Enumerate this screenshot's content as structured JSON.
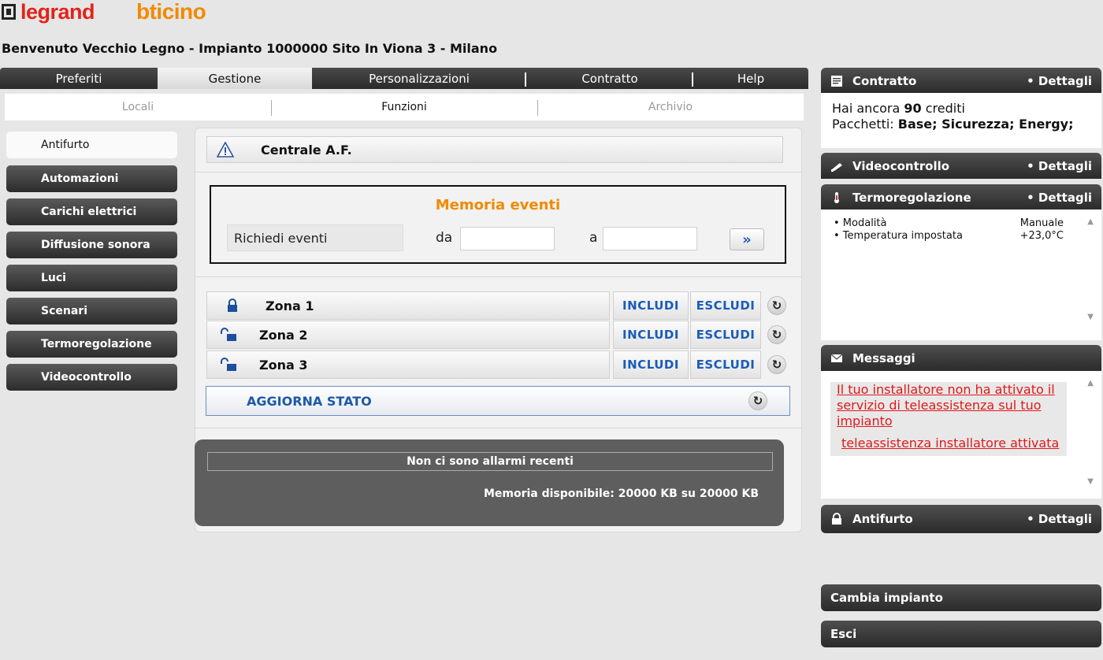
{
  "header": {
    "logo_legrand": "legrand",
    "logo_bticino": "bticino",
    "welcome": "Benvenuto Vecchio Legno - Impianto 1000000 Sito In Viona 3 - Milano"
  },
  "top_tabs": [
    "Preferiti",
    "Gestione",
    "Personalizzazioni",
    "Contratto",
    "Help"
  ],
  "active_top_tab": "Gestione",
  "sub_tabs": [
    "Locali",
    "Funzioni",
    "Archivio"
  ],
  "active_sub_tab": "Funzioni",
  "side_menu": [
    "Antifurto",
    "Automazioni",
    "Carichi elettrici",
    "Diffusione sonora",
    "Luci",
    "Scenari",
    "Termoregolazione",
    "Videocontrollo"
  ],
  "active_side": "Antifurto",
  "centrale": {
    "title": "Centrale A.F.",
    "icon": "warning-icon"
  },
  "memoria": {
    "title": "Memoria eventi",
    "richiedi": "Richiedi eventi",
    "da_label": "da",
    "a_label": "a",
    "da_value": "",
    "a_value": "",
    "go_label": "»"
  },
  "zones": [
    {
      "name": "Zona 1",
      "state": "locked",
      "icon": "lock-closed-icon"
    },
    {
      "name": "Zona 2",
      "state": "unlocked",
      "icon": "lock-open-icon"
    },
    {
      "name": "Zona 3",
      "state": "unlocked",
      "icon": "lock-open-icon"
    }
  ],
  "zone_buttons": {
    "include": "INCLUDI",
    "exclude": "ESCLUDI",
    "refresh_glyph": "↻"
  },
  "aggiorna": "AGGIORNA STATO",
  "alarms": {
    "message": "Non ci sono allarmi recenti",
    "memory": "Memoria disponibile: 20000 KB su 20000 KB"
  },
  "right": {
    "contratto": {
      "title": "Contratto",
      "details": "• Dettagli",
      "credits_prefix": "Hai ancora ",
      "credits_value": "90",
      "credits_suffix": " crediti",
      "packages_label": "Pacchetti: ",
      "packages_value": "Base; Sicurezza; Energy;"
    },
    "videocontrollo": {
      "title": "Videocontrollo",
      "details": "• Dettagli"
    },
    "termoregolazione": {
      "title": "Termoregolazione",
      "details": "• Dettagli",
      "rows": [
        {
          "label": "• Modalità",
          "value": "Manuale"
        },
        {
          "label": "• Temperatura impostata",
          "value": "+23,0°C"
        }
      ]
    },
    "messaggi": {
      "title": "Messaggi",
      "items": [
        "Il tuo installatore non ha attivato il servizio di teleassistenza sul tuo impianto",
        "teleassistenza installatore attivata"
      ]
    },
    "antifurto": {
      "title": "Antifurto",
      "details": "• Dettagli"
    },
    "cambia_impianto": "Cambia impianto",
    "esci": "Esci"
  },
  "colors": {
    "accent_orange": "#f08a00",
    "link_blue": "#1b5cb8",
    "message_red": "#e0181a",
    "dark_bar": "#2a2a2a"
  }
}
